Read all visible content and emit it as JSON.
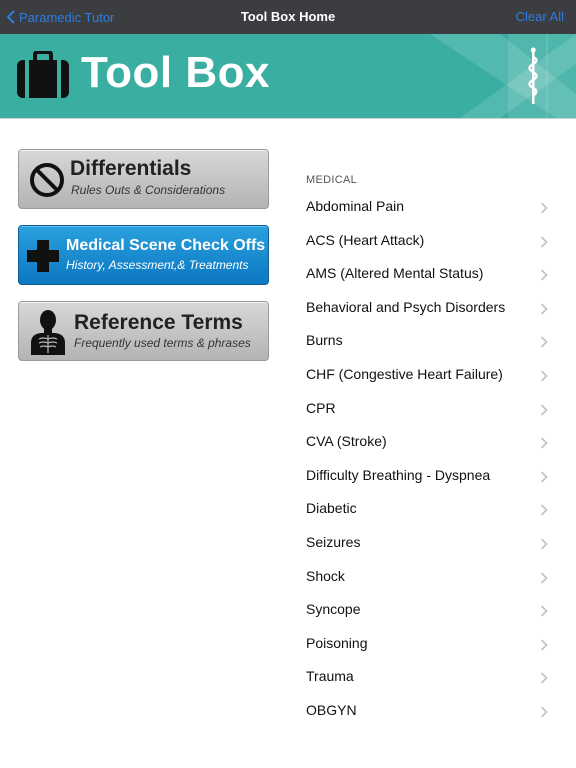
{
  "nav": {
    "back_label": "Paramedic Tutor",
    "title": "Tool Box Home",
    "clear_label": "Clear All"
  },
  "banner": {
    "title": "Tool Box"
  },
  "colors": {
    "nav_background": "#3b3d40",
    "link_blue": "#2c7de0",
    "banner_teal": "#3aaea1",
    "button_gray": "#c4c4c4",
    "button_blue": "#1a8fd2"
  },
  "tools": [
    {
      "title": "Differentials",
      "subtitle": "Rules Outs & Considerations",
      "icon": "no-entry-icon",
      "style": "gray"
    },
    {
      "title": "Medical Scene Check Offs",
      "subtitle": "History, Assessment,& Treatments",
      "icon": "medical-cross-icon",
      "style": "blue"
    },
    {
      "title": "Reference Terms",
      "subtitle": "Frequently used terms & phrases",
      "icon": "anatomy-icon",
      "style": "gray"
    }
  ],
  "list": {
    "section_header": "MEDICAL",
    "items": [
      "Abdominal Pain",
      "ACS (Heart Attack)",
      "AMS (Altered Mental Status)",
      "Behavioral and Psych Disorders",
      "Burns",
      "CHF (Congestive Heart Failure)",
      "CPR",
      "CVA (Stroke)",
      "Difficulty Breathing - Dyspnea",
      "Diabetic",
      "Seizures",
      "Shock",
      "Syncope",
      "Poisoning",
      "Trauma",
      "OBGYN"
    ]
  }
}
